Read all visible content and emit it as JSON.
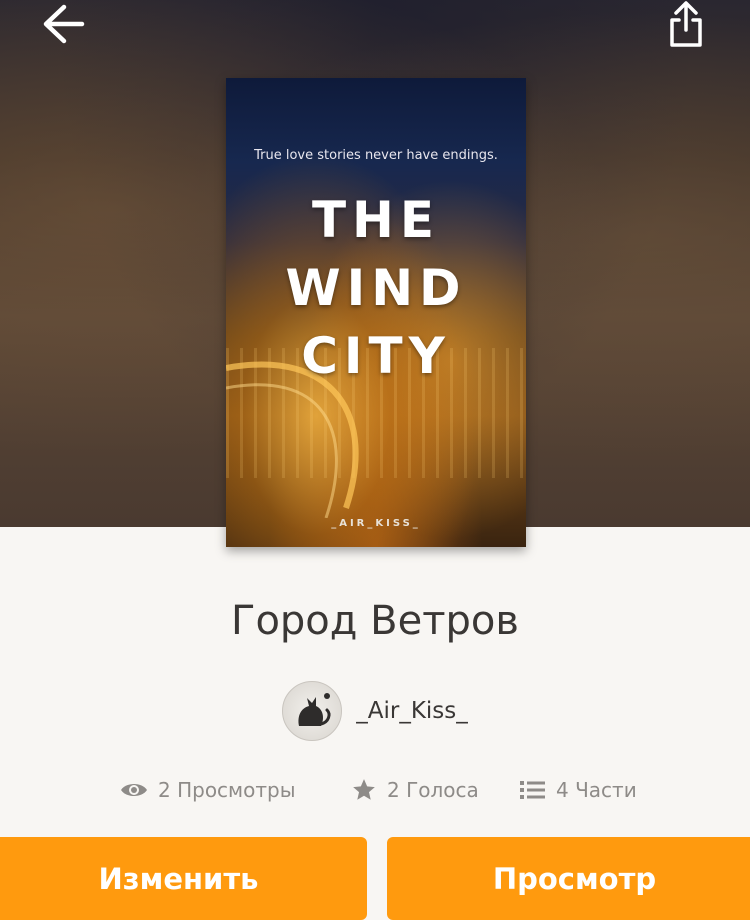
{
  "header": {
    "back_icon": "arrow-left-icon",
    "share_icon": "share-icon"
  },
  "cover": {
    "tagline": "True love stories never have endings.",
    "title_line1": "THE",
    "title_line2": "WIND",
    "title_line3": "CITY",
    "author": "_AIR_KISS_"
  },
  "story": {
    "title": "Город Ветров",
    "author": "_Air_Kiss_"
  },
  "stats": {
    "views": {
      "icon": "eye-icon",
      "label": "2 Просмотры"
    },
    "votes": {
      "icon": "star-icon",
      "label": "2 Голоса"
    },
    "parts": {
      "icon": "list-icon",
      "label": "4 Части"
    }
  },
  "actions": {
    "edit_label": "Изменить",
    "preview_label": "Просмотр"
  },
  "colors": {
    "accent": "#ff9a0e",
    "text": "#3a3735",
    "muted": "#8e8b88",
    "background": "#f8f6f3"
  }
}
